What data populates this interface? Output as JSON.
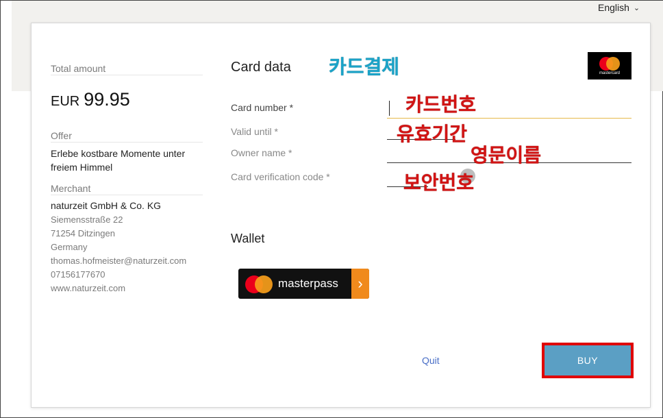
{
  "header": {
    "language": "English"
  },
  "summary": {
    "total_label": "Total amount",
    "currency": "EUR",
    "amount": "99.95",
    "offer_label": "Offer",
    "offer_text": "Erlebe kostbare Momente unter freiem Himmel",
    "merchant_label": "Merchant",
    "merchant_name": "naturzeit GmbH & Co. KG",
    "merchant_lines": [
      "Siemensstraße 22",
      "71254 Ditzingen",
      "Germany",
      "thomas.hofmeister@naturzeit.com",
      "07156177670",
      "www.naturzeit.com"
    ]
  },
  "card": {
    "title": "Card data",
    "card_brand_logo": "mastercard",
    "fields": {
      "card_number": "Card number *",
      "valid_until": "Valid until *",
      "owner_name": "Owner name *",
      "cvc": "Card verification code *"
    }
  },
  "annotations": {
    "card_payment": "카드결제",
    "card_number": "카드번호",
    "validity": "유효기간",
    "english_name": "영문이름",
    "security_code": "보안번호"
  },
  "wallet": {
    "title": "Wallet",
    "masterpass_label": "masterpass",
    "masterpass_icon": "chevron-right-icon"
  },
  "actions": {
    "quit_label": "Quit",
    "buy_label": "BUY"
  },
  "colors": {
    "buy_button": "#5b9fc4",
    "highlight_border": "#e00000",
    "annotation_red": "#d21414",
    "annotation_cyan": "#1aa3c8",
    "quit_link": "#4a6fc7"
  }
}
